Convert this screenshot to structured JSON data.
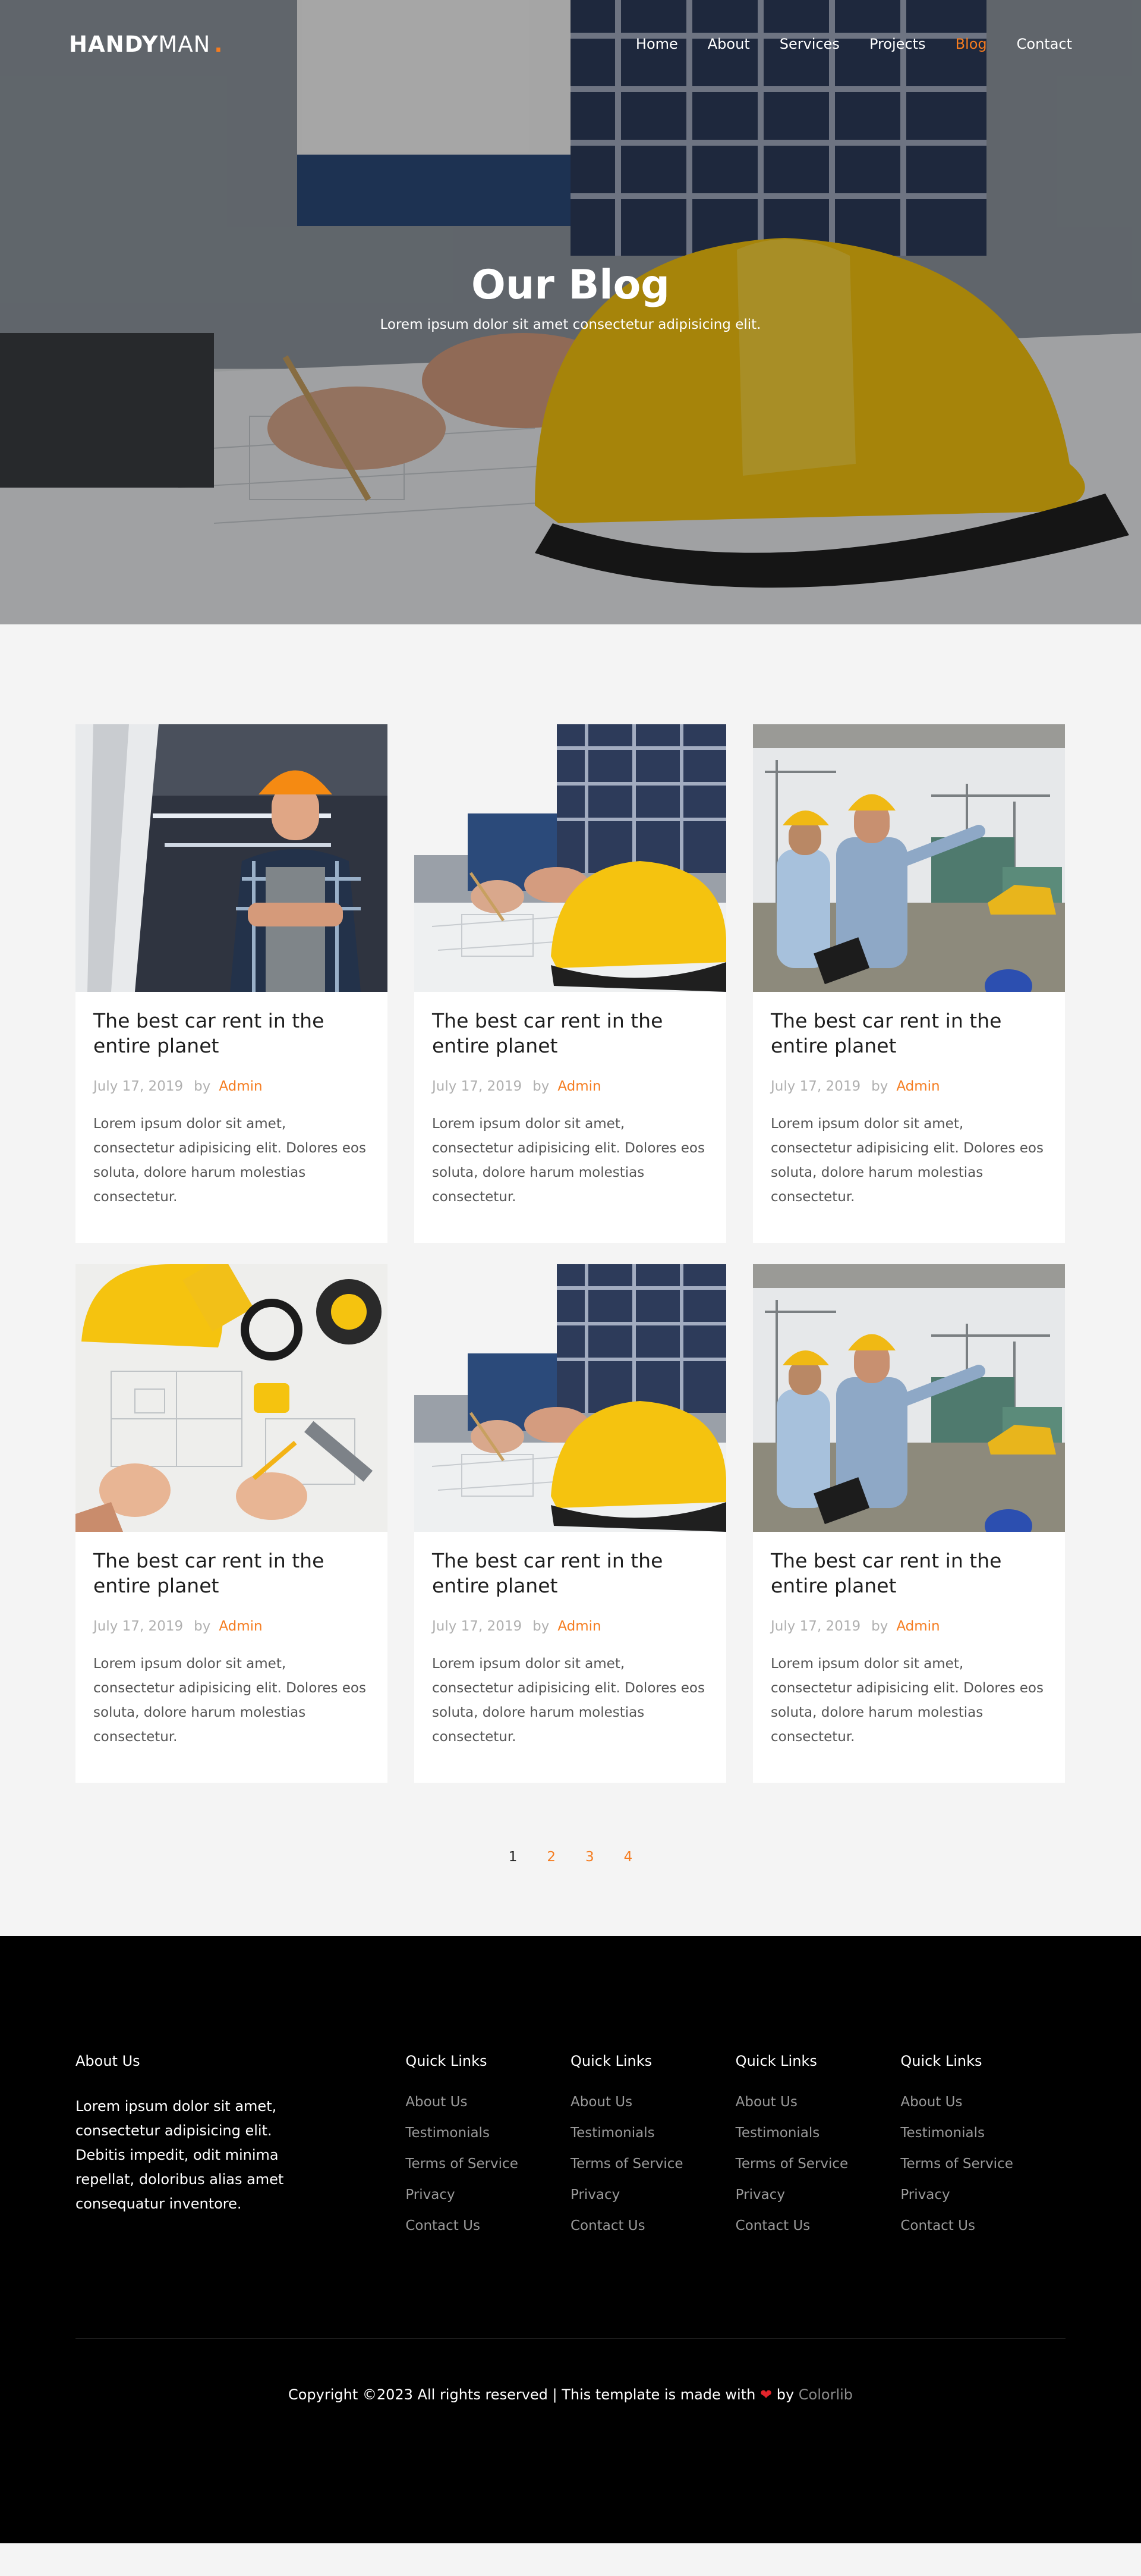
{
  "brand": {
    "name_bold": "HANDY",
    "name_light": "MAN",
    "dot": "."
  },
  "nav": {
    "items": [
      {
        "label": "Home"
      },
      {
        "label": "About"
      },
      {
        "label": "Services"
      },
      {
        "label": "Projects"
      },
      {
        "label": "Blog"
      },
      {
        "label": "Contact"
      }
    ],
    "active": "Blog"
  },
  "hero": {
    "title": "Our Blog",
    "subtitle": "Lorem ipsum dolor sit amet consectetur adipisicing elit."
  },
  "posts": [
    {
      "image": "worker-portrait",
      "title": "The best car rent in the entire planet",
      "date": "July 17, 2019",
      "by": "by",
      "author": "Admin",
      "excerpt": "Lorem ipsum dolor sit amet, consectetur adipisicing elit. Dolores eos soluta, dolore harum molestias consectetur."
    },
    {
      "image": "blueprint-helmet",
      "title": "The best car rent in the entire planet",
      "date": "July 17, 2019",
      "by": "by",
      "author": "Admin",
      "excerpt": "Lorem ipsum dolor sit amet, consectetur adipisicing elit. Dolores eos soluta, dolore harum molestias consectetur."
    },
    {
      "image": "construction-site",
      "title": "The best car rent in the entire planet",
      "date": "July 17, 2019",
      "by": "by",
      "author": "Admin",
      "excerpt": "Lorem ipsum dolor sit amet, consectetur adipisicing elit. Dolores eos soluta, dolore harum molestias consectetur."
    },
    {
      "image": "tools-drawing",
      "title": "The best car rent in the entire planet",
      "date": "July 17, 2019",
      "by": "by",
      "author": "Admin",
      "excerpt": "Lorem ipsum dolor sit amet, consectetur adipisicing elit. Dolores eos soluta, dolore harum molestias consectetur."
    },
    {
      "image": "blueprint-helmet",
      "title": "The best car rent in the entire planet",
      "date": "July 17, 2019",
      "by": "by",
      "author": "Admin",
      "excerpt": "Lorem ipsum dolor sit amet, consectetur adipisicing elit. Dolores eos soluta, dolore harum molestias consectetur."
    },
    {
      "image": "construction-site",
      "title": "The best car rent in the entire planet",
      "date": "July 17, 2019",
      "by": "by",
      "author": "Admin",
      "excerpt": "Lorem ipsum dolor sit amet, consectetur adipisicing elit. Dolores eos soluta, dolore harum molestias consectetur."
    }
  ],
  "pagination": {
    "pages": [
      "1",
      "2",
      "3",
      "4"
    ],
    "current": "1"
  },
  "footer": {
    "about": {
      "heading": "About Us",
      "text": "Lorem ipsum dolor sit amet, consectetur adipisicing elit. Debitis impedit, odit minima repellat, doloribus alias amet consequatur inventore."
    },
    "link_columns": [
      {
        "heading": "Quick Links",
        "links": [
          "About Us",
          "Testimonials",
          "Terms of Service",
          "Privacy",
          "Contact Us"
        ]
      },
      {
        "heading": "Quick Links",
        "links": [
          "About Us",
          "Testimonials",
          "Terms of Service",
          "Privacy",
          "Contact Us"
        ]
      },
      {
        "heading": "Quick Links",
        "links": [
          "About Us",
          "Testimonials",
          "Terms of Service",
          "Privacy",
          "Contact Us"
        ]
      },
      {
        "heading": "Quick Links",
        "links": [
          "About Us",
          "Testimonials",
          "Terms of Service",
          "Privacy",
          "Contact Us"
        ]
      }
    ],
    "copyright": {
      "prefix": "Copyright ©2023 All rights reserved | This template is made with",
      "heart": "❤",
      "by": "by",
      "credit": "Colorlib"
    }
  },
  "colors": {
    "accent": "#f57c1f",
    "footer_bg": "#000000",
    "page_bg": "#f4f4f4"
  }
}
